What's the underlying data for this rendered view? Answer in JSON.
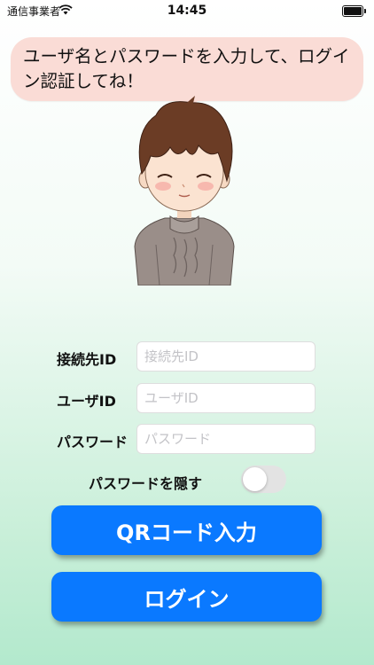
{
  "status_bar": {
    "carrier": "通信事業者",
    "time": "14:45"
  },
  "speech_bubble": {
    "message": "ユーザ名とパスワードを入力して、ログイン認証してね！"
  },
  "form": {
    "connection_id": {
      "label": "接続先ID",
      "placeholder": "接続先ID",
      "value": ""
    },
    "user_id": {
      "label": "ユーザID",
      "placeholder": "ユーザID",
      "value": ""
    },
    "password": {
      "label": "パスワード",
      "placeholder": "パスワード",
      "value": ""
    },
    "hide_password": {
      "label": "パスワードを隠す",
      "on": false
    }
  },
  "buttons": {
    "qr": "QRコード入力",
    "login": "ログイン"
  },
  "colors": {
    "accent": "#0a79ff",
    "bubble": "#fadcd6"
  }
}
